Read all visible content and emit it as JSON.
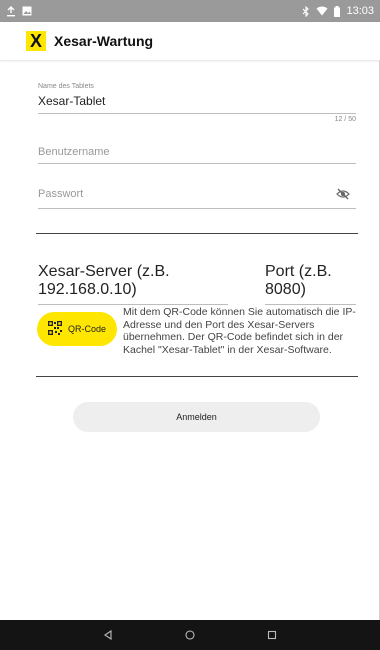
{
  "status_bar": {
    "time": "13:03",
    "icons": [
      "upload-icon",
      "image-icon",
      "bluetooth-icon",
      "wifi-icon",
      "battery-icon"
    ]
  },
  "app_bar": {
    "logo_letter": "X",
    "title": "Xesar-Wartung",
    "logo_color": "#ffe600"
  },
  "form": {
    "tablet_name": {
      "label": "Name des Tablets",
      "value": "Xesar-Tablet",
      "counter": "12 / 50"
    },
    "username": {
      "placeholder": "Benutzername"
    },
    "password": {
      "placeholder": "Passwort",
      "toggle_icon": "visibility-off-icon"
    },
    "server": {
      "placeholder": "Xesar-Server (z.B. 192.168.0.10)"
    },
    "port": {
      "placeholder": "Port (z.B. 8080)"
    }
  },
  "qr": {
    "button_label": "QR-Code",
    "description": "Mit dem QR-Code können Sie automatisch die IP-Adresse und den Port des Xesar-Servers übernehmen. Der QR-Code befindet sich in der Kachel \"Xesar-Tablet\" in der Xesar-Software."
  },
  "login": {
    "label": "Anmelden"
  },
  "nav_bar": {
    "icons": [
      "back-icon",
      "home-icon",
      "recents-icon"
    ]
  },
  "colors": {
    "accent": "#ffe600",
    "status_bar": "#9a9a9a",
    "nav_bar": "#141414",
    "button_gray": "#eeeeee"
  }
}
